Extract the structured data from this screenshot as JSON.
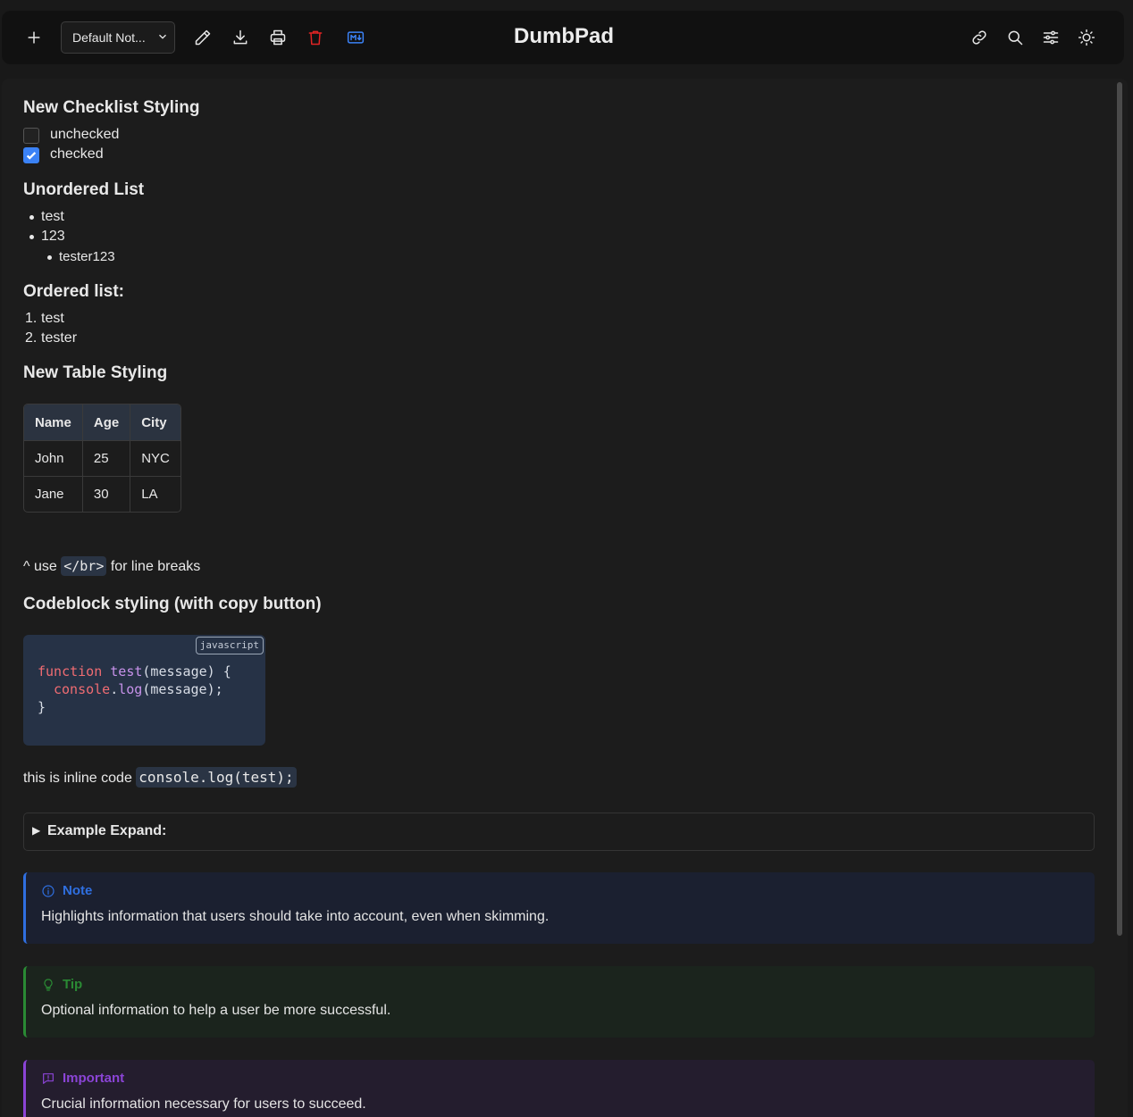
{
  "header": {
    "app_title": "DumbPad",
    "note_select": {
      "value": "Default Not..."
    }
  },
  "content": {
    "checklist": {
      "heading": "New Checklist Styling",
      "items": [
        {
          "label": "unchecked",
          "checked": false
        },
        {
          "label": "checked",
          "checked": true
        }
      ]
    },
    "unordered": {
      "heading": "Unordered List",
      "items": [
        "test",
        "123"
      ],
      "nested": [
        "tester123"
      ]
    },
    "ordered": {
      "heading": "Ordered list:",
      "items": [
        {
          "marker": "1.",
          "text": "test"
        },
        {
          "marker": "2.",
          "text": "tester"
        }
      ]
    },
    "table": {
      "heading": "New Table Styling",
      "headers": [
        "Name",
        "Age",
        "City"
      ],
      "rows": [
        [
          "John",
          "25",
          "NYC"
        ],
        [
          "Jane",
          "30",
          "LA"
        ]
      ]
    },
    "linebreak": {
      "prefix": "^ use",
      "code": "</br>",
      "suffix": "for line breaks"
    },
    "codeblock": {
      "heading": "Codeblock styling (with copy button)",
      "language": "javascript",
      "lines": {
        "l1_kw": "function",
        "l1_fn": "test",
        "l1_rest": "(message) {",
        "l2_obj": "console",
        "l2_dot": ".",
        "l2_fn": "log",
        "l2_rest": "(message);",
        "l3": "}"
      }
    },
    "inline_code": {
      "text": "this is inline code",
      "code": "console.log(test);"
    },
    "details": {
      "summary": "Example Expand:"
    },
    "callouts": [
      {
        "title": "Note",
        "text": "Highlights information that users should take into account, even when skimming.",
        "color": "#2f6fe0",
        "bg": "#1b2030"
      },
      {
        "title": "Tip",
        "text": "Optional information to help a user be more successful.",
        "color": "#2a8a34",
        "bg": "#1b241d"
      },
      {
        "title": "Important",
        "text": "Crucial information necessary for users to succeed.",
        "color": "#8b44d6",
        "bg": "#241d2e"
      }
    ]
  },
  "icons": {
    "toolbar_left": [
      "plus-icon",
      "pencil-icon",
      "download-icon",
      "printer-icon",
      "trash-icon",
      "markdown-icon"
    ],
    "toolbar_right": [
      "link-icon",
      "search-icon",
      "sliders-icon",
      "sun-icon"
    ]
  },
  "colors": {
    "trash": "#e02424",
    "markdown": "#3b82f6",
    "checkbox_checked": "#3b82f6"
  }
}
